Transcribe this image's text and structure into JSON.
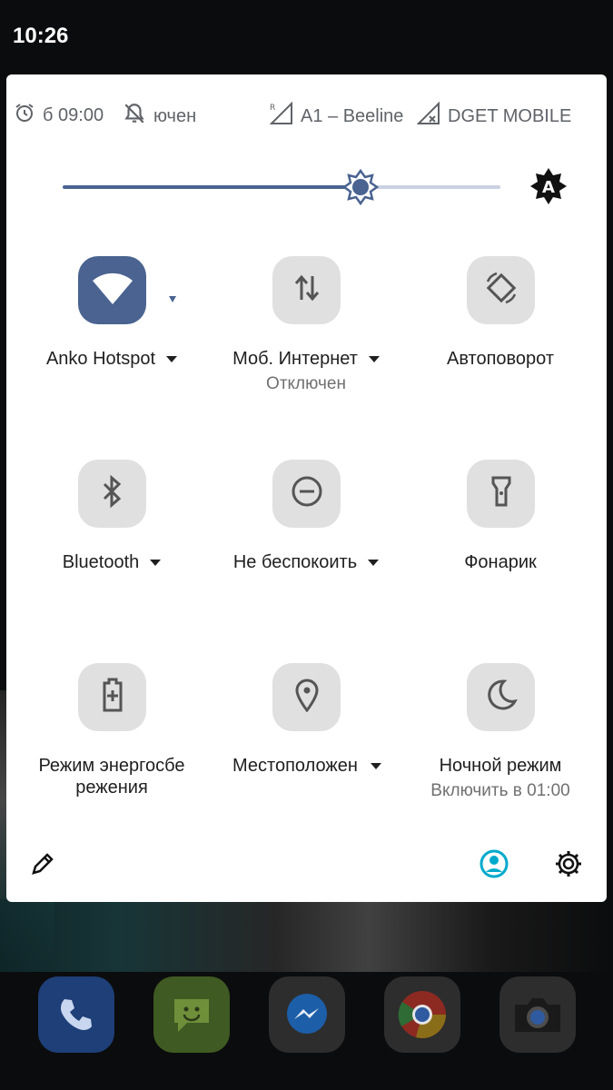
{
  "status_bar": {
    "time": "10:26"
  },
  "info": {
    "alarm_text": "б 09:00",
    "dnd_text": "ючен",
    "sim1": "A1 – Beeline",
    "sim2": "DGET MOBILE"
  },
  "brightness": {
    "level": 0.68,
    "auto_letter": "A"
  },
  "tiles": [
    {
      "label": "Anko Hotspot",
      "sub": "",
      "icon": "wifi-icon",
      "active": true
    },
    {
      "label": "Моб. Интернет",
      "sub": "Отключен",
      "icon": "mobile-data-icon",
      "active": false
    },
    {
      "label": "Автоповорот",
      "sub": "",
      "icon": "auto-rotate-icon",
      "active": false
    },
    {
      "label": "Bluetooth",
      "sub": "",
      "icon": "bluetooth-icon",
      "active": false
    },
    {
      "label": "Не беспокоить",
      "sub": "",
      "icon": "do-not-disturb-icon",
      "active": false
    },
    {
      "label": "Фонарик",
      "sub": "",
      "icon": "flashlight-icon",
      "active": false
    },
    {
      "label_line1": "Режим энергосбе",
      "label_line2": "режения",
      "sub": "",
      "icon": "battery-saver-icon",
      "active": false
    },
    {
      "label": "Местоположен",
      "sub": "",
      "icon": "location-icon",
      "active": false
    },
    {
      "label": "Ночной режим",
      "sub": "Включить в 01:00",
      "icon": "night-mode-icon",
      "active": false
    }
  ],
  "dock": [
    "phone-icon",
    "messaging-icon",
    "messenger-icon",
    "chrome-icon",
    "camera-icon"
  ],
  "colors": {
    "accent": "#4a6390",
    "user_icon": "#00aacc"
  }
}
